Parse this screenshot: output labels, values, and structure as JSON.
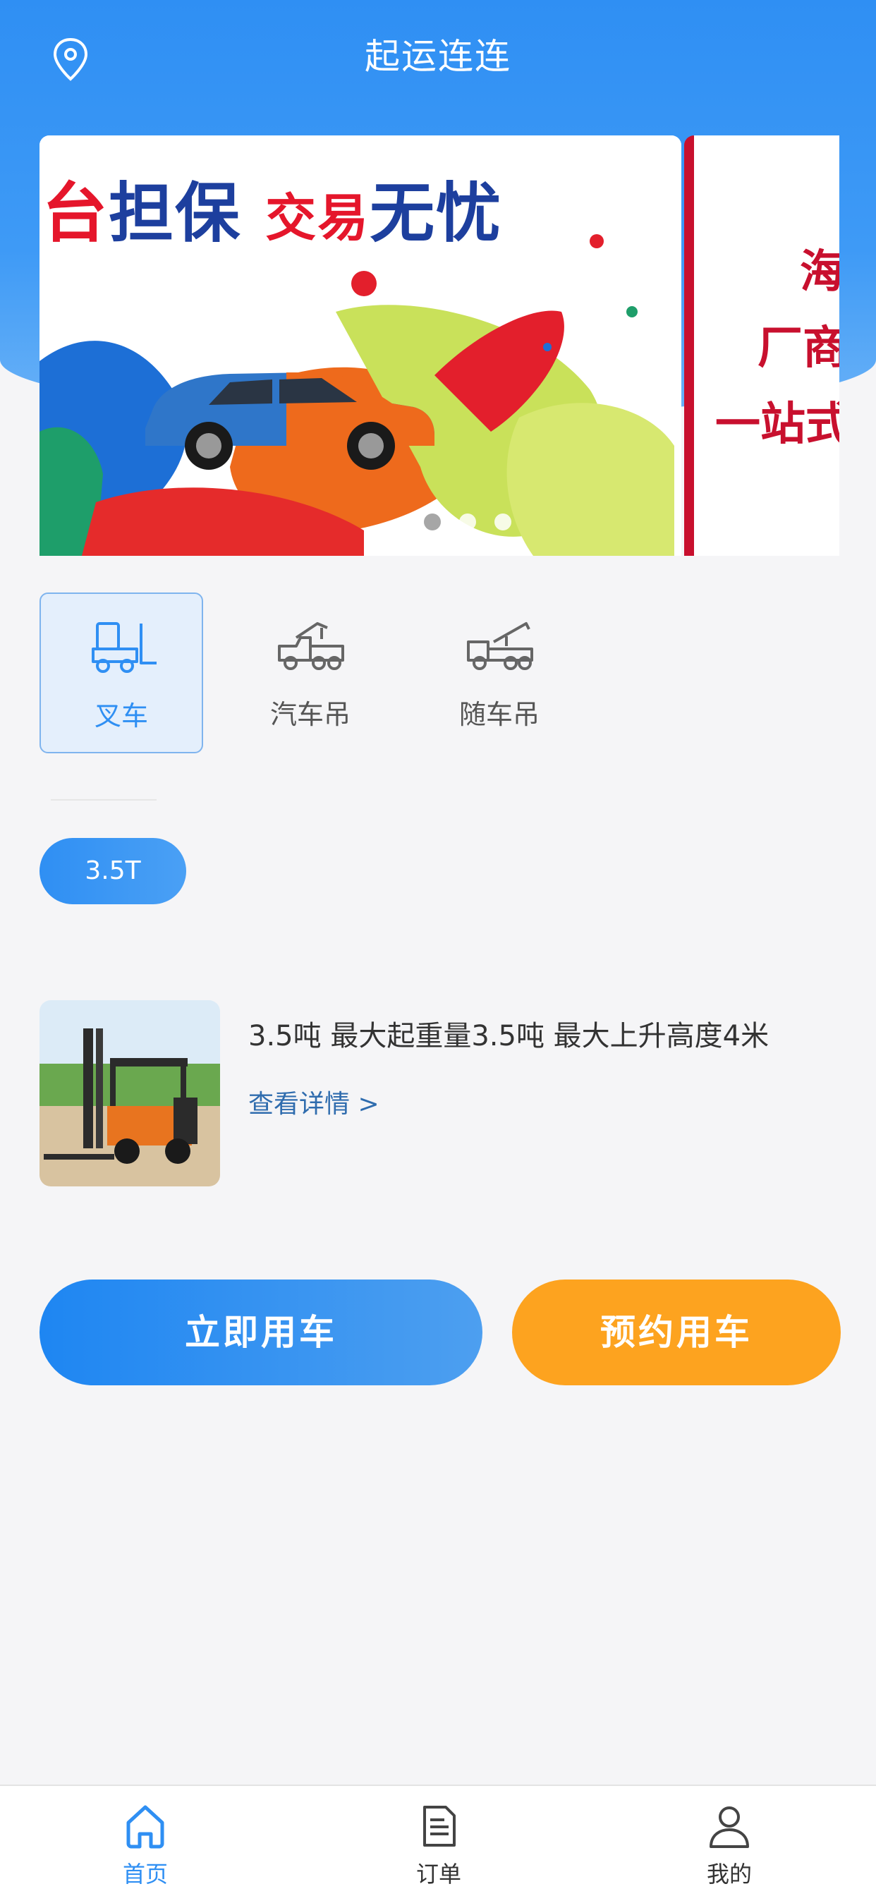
{
  "header": {
    "title": "起运连连",
    "location_icon": "location-pin-icon"
  },
  "banner": {
    "slide1_text_red_1": "台",
    "slide1_text_blue_1": "担保",
    "slide1_text_red_2": "交易",
    "slide1_text_blue_2": "无忧",
    "slide2_lines": [
      "海",
      "厂商",
      "一站式"
    ],
    "dot_count": 3,
    "active_dot": 0
  },
  "categories": [
    {
      "label": "叉车",
      "icon": "forklift-icon",
      "selected": true
    },
    {
      "label": "汽车吊",
      "icon": "truck-crane-icon",
      "selected": false
    },
    {
      "label": "随车吊",
      "icon": "truck-mounted-crane-icon",
      "selected": false
    }
  ],
  "tonnage_chip": "3.5T",
  "product": {
    "description": "3.5吨  最大起重量3.5吨  最大上升高度4米",
    "details_link": "查看详情 >"
  },
  "buttons": {
    "use_now": "立即用车",
    "book": "预约用车"
  },
  "tabbar": [
    {
      "label": "首页",
      "icon": "home-icon",
      "active": true
    },
    {
      "label": "订单",
      "icon": "order-document-icon",
      "active": false
    },
    {
      "label": "我的",
      "icon": "user-profile-icon",
      "active": false
    }
  ],
  "colors": {
    "primary": "#2f8ff3",
    "accent_orange": "#fda31f",
    "background": "#f5f5f7"
  }
}
